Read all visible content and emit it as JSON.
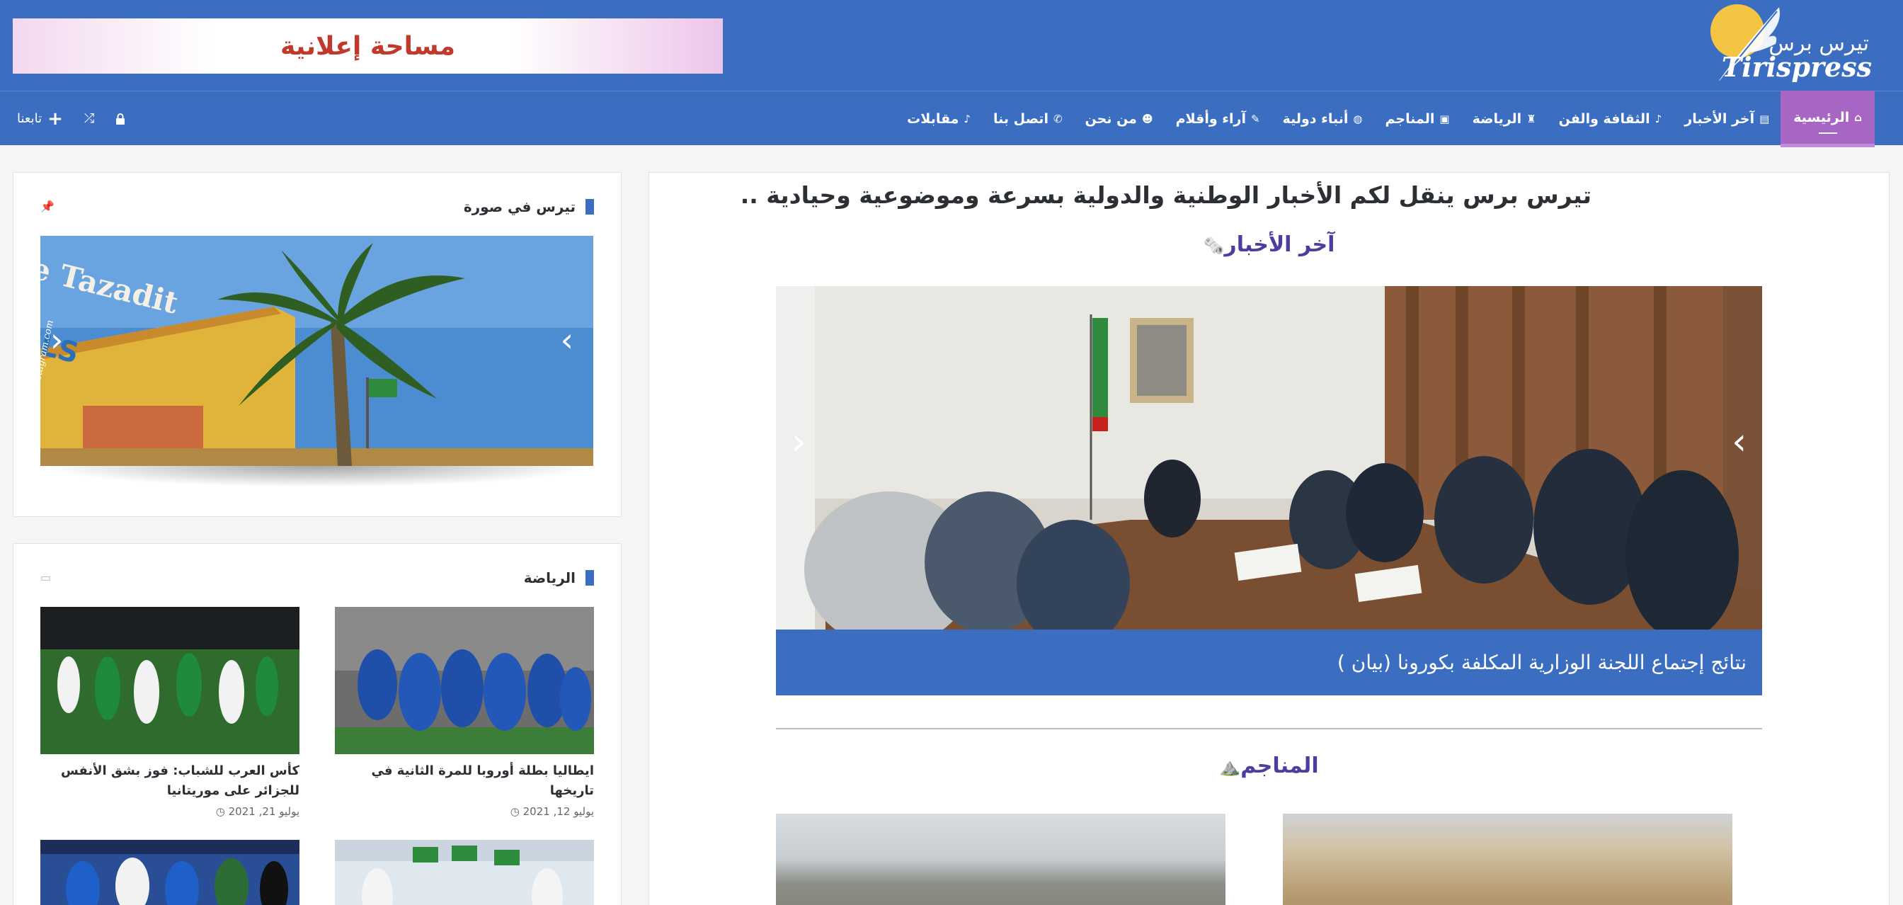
{
  "header": {
    "logo_ar": "تيرس برس",
    "logo_en": "Tirispress",
    "ad_text": "مساحة إعلانية"
  },
  "nav": {
    "items": [
      {
        "label": "الرئيسية",
        "icon": "home-icon",
        "active": true
      },
      {
        "label": "آخر الأخبار",
        "icon": "newspaper-icon"
      },
      {
        "label": "الثقافة والفن",
        "icon": "microphone-icon"
      },
      {
        "label": "الرياضة",
        "icon": "trophy-icon"
      },
      {
        "label": "المناجم",
        "icon": "money-icon"
      },
      {
        "label": "أنباء دولية",
        "icon": "globe-icon"
      },
      {
        "label": "آراء وأقلام",
        "icon": "pencil-icon"
      },
      {
        "label": "من نحن",
        "icon": "users-icon"
      },
      {
        "label": "اتصل بنا",
        "icon": "phone-icon"
      },
      {
        "label": "مقابلات",
        "icon": "microphone-icon"
      }
    ],
    "follow_label": "تابعنا"
  },
  "main": {
    "headline": "تيرس برس ينقل لكم الأخبار الوطنية والدولية بسرعة وموضوعية وحيادية ..",
    "latest_title": "آخر الأخبار",
    "latest_emoji": "🗞️",
    "slide_caption": "نتائج إجتماع اللجنة الوزارية المكلفة بكورونا (بيان )",
    "mines_title": "المناجم",
    "mines_emoji": "⛰️"
  },
  "sidebar": {
    "photo_widget_title": "تيرس في صورة",
    "sports_widget_title": "الرياضة",
    "photo_sign_1": "Le Tazadit",
    "photo_sign_2": "HOTELS",
    "photo_watermark": "instagram.com/...",
    "sports_posts": [
      {
        "title": "ايطاليا بطلة أوروبا للمرة الثانية في تاريخها",
        "date": "يوليو 12, 2021"
      },
      {
        "title": "كأس العرب للشباب: فوز بشق الأنفس للجزائر على موريتانيا",
        "date": "يوليو 21, 2021"
      }
    ]
  },
  "colors": {
    "header_blue": "#3b6ec1",
    "nav_active": "#a866c4",
    "section_title": "#4d3d9f",
    "ad_text": "#c0392b"
  }
}
